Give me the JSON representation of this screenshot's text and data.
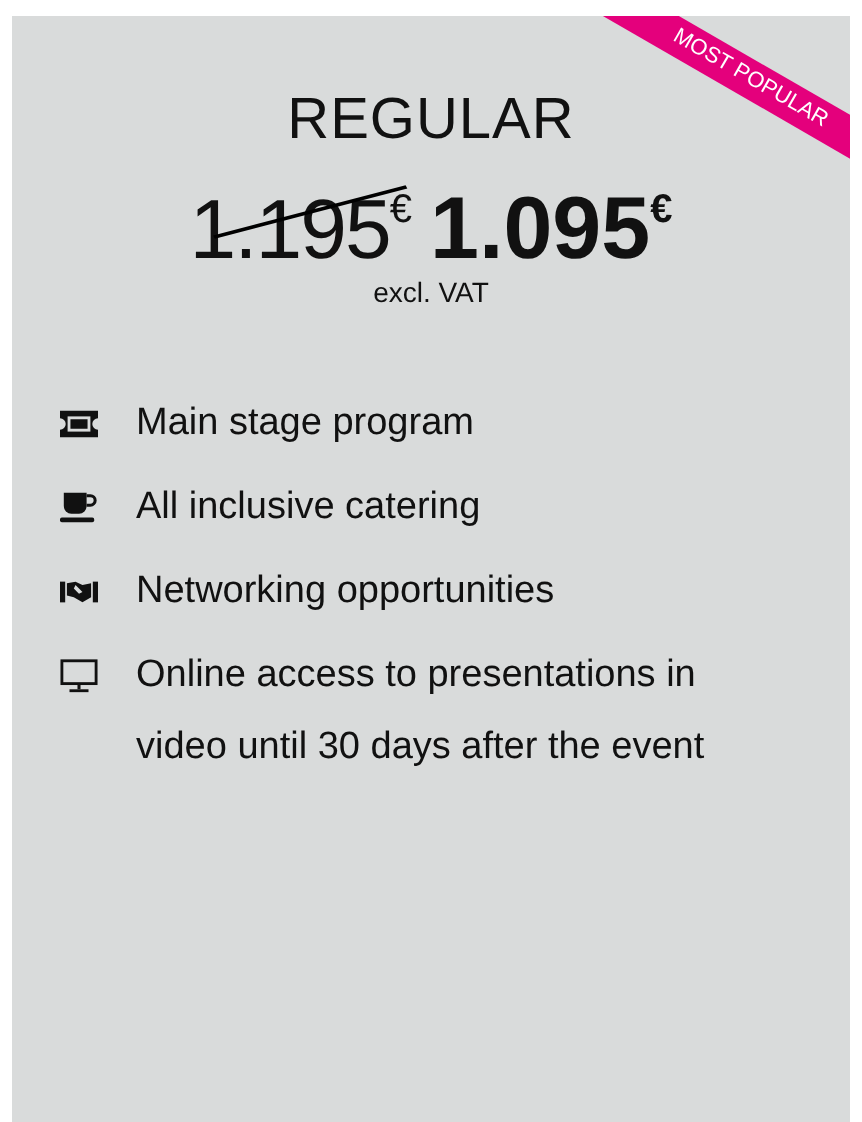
{
  "ribbon": "MOST POPULAR",
  "plan": "REGULAR",
  "old_price": "1.195$^{€}$",
  "price": "1.095$^{€}$",
  "price_note": "excl. VAT",
  "features": [
    {
      "kind": "ticket",
      "text": "Main stage program"
    },
    {
      "kind": "cup",
      "text": "All inclusive catering"
    },
    {
      "kind": "handshake",
      "text": "Networking opportunities"
    },
    {
      "kind": "monitor",
      "text": "Online access to presentations in video until 30 days after the event"
    }
  ]
}
